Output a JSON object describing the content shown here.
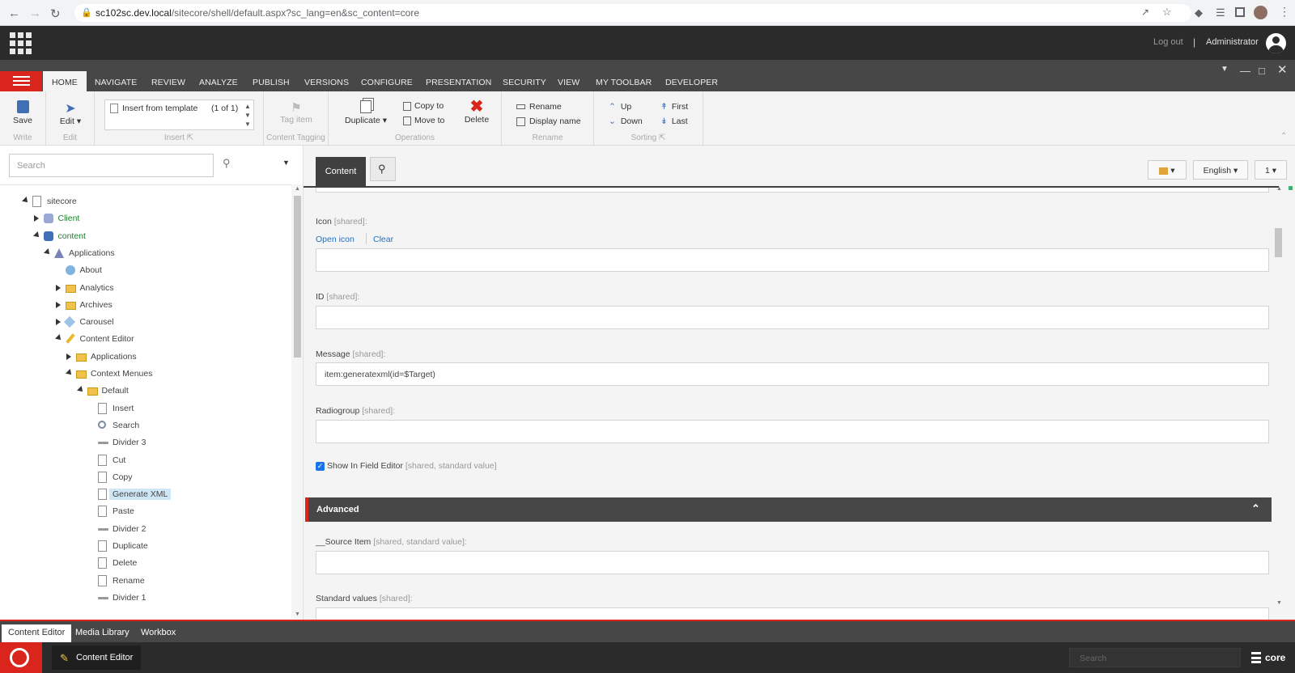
{
  "browser": {
    "url_domain": "sc102sc.dev.local",
    "url_path": "/sitecore/shell/default.aspx?sc_lang=en&sc_content=core"
  },
  "topbar": {
    "logout": "Log out",
    "separator": "|",
    "user": "Administrator"
  },
  "tabs": [
    "HOME",
    "NAVIGATE",
    "REVIEW",
    "ANALYZE",
    "PUBLISH",
    "VERSIONS",
    "CONFIGURE",
    "PRESENTATION",
    "SECURITY",
    "VIEW",
    "MY TOOLBAR",
    "DEVELOPER"
  ],
  "ribbon": {
    "write": {
      "save": "Save",
      "label": "Write"
    },
    "edit": {
      "edit": "Edit",
      "label": "Edit"
    },
    "insert": {
      "item": "Insert from template",
      "count": "(1 of 1)",
      "label": "Insert"
    },
    "tagging": {
      "tag": "Tag item",
      "label": "Content Tagging"
    },
    "operations": {
      "duplicate": "Duplicate",
      "copy": "Copy to",
      "move": "Move to",
      "delete": "Delete",
      "label": "Operations"
    },
    "rename": {
      "rename": "Rename",
      "display": "Display name",
      "label": "Rename"
    },
    "sorting": {
      "up": "Up",
      "down": "Down",
      "first": "First",
      "last": "Last",
      "label": "Sorting"
    }
  },
  "search": {
    "placeholder": "Search"
  },
  "tree": [
    {
      "label": "sitecore",
      "icon": "page",
      "indent": 0,
      "arrow": "open"
    },
    {
      "label": "Client",
      "icon": "client",
      "indent": 1,
      "arrow": "closed",
      "green": true
    },
    {
      "label": "content",
      "icon": "content",
      "indent": 1,
      "arrow": "open",
      "green": true
    },
    {
      "label": "Applications",
      "icon": "apps",
      "indent": 2,
      "arrow": "open"
    },
    {
      "label": "About",
      "icon": "info",
      "indent": 3,
      "arrow": ""
    },
    {
      "label": "Analytics",
      "icon": "folder",
      "indent": 3,
      "arrow": "closed"
    },
    {
      "label": "Archives",
      "icon": "folder",
      "indent": 3,
      "arrow": "closed"
    },
    {
      "label": "Carousel",
      "icon": "star",
      "indent": 3,
      "arrow": "closed"
    },
    {
      "label": "Content Editor",
      "icon": "pencil",
      "indent": 3,
      "arrow": "open"
    },
    {
      "label": "Applications",
      "icon": "folder",
      "indent": 4,
      "arrow": "closed"
    },
    {
      "label": "Context Menues",
      "icon": "folder",
      "indent": 4,
      "arrow": "open"
    },
    {
      "label": "Default",
      "icon": "folder",
      "indent": 5,
      "arrow": "open"
    },
    {
      "label": "Insert",
      "icon": "page",
      "indent": 6,
      "arrow": ""
    },
    {
      "label": "Search",
      "icon": "search",
      "indent": 6,
      "arrow": ""
    },
    {
      "label": "Divider 3",
      "icon": "div",
      "indent": 6,
      "arrow": ""
    },
    {
      "label": "Cut",
      "icon": "page",
      "indent": 6,
      "arrow": ""
    },
    {
      "label": "Copy",
      "icon": "page",
      "indent": 6,
      "arrow": ""
    },
    {
      "label": "Generate XML",
      "icon": "page",
      "indent": 6,
      "arrow": "",
      "selected": true
    },
    {
      "label": "Paste",
      "icon": "page",
      "indent": 6,
      "arrow": ""
    },
    {
      "label": "Divider 2",
      "icon": "div",
      "indent": 6,
      "arrow": ""
    },
    {
      "label": "Duplicate",
      "icon": "page",
      "indent": 6,
      "arrow": ""
    },
    {
      "label": "Delete",
      "icon": "page",
      "indent": 6,
      "arrow": ""
    },
    {
      "label": "Rename",
      "icon": "page",
      "indent": 6,
      "arrow": ""
    },
    {
      "label": "Divider 1",
      "icon": "div",
      "indent": 6,
      "arrow": ""
    }
  ],
  "editor": {
    "content_tab": "Content",
    "language": "English",
    "version": "1"
  },
  "fields": {
    "icon_label": "Icon",
    "icon_shared": "[shared]:",
    "open_icon": "Open icon",
    "clear": "Clear",
    "id_label": "ID",
    "id_shared": "[shared]:",
    "message_label": "Message",
    "message_shared": "[shared]:",
    "message_value": "item:generatexml(id=$Target)",
    "radiogroup_label": "Radiogroup",
    "radiogroup_shared": "[shared]:",
    "show_label": "Show In Field Editor",
    "show_shared": "[shared, standard value]",
    "advanced": "Advanced",
    "source_label": "__Source Item",
    "source_shared": "[shared, standard value]:",
    "standard_label": "Standard values",
    "standard_shared": "[shared]:"
  },
  "bottom_tabs": [
    "Content Editor",
    "Media Library",
    "Workbox"
  ],
  "taskbar": {
    "app": "Content Editor",
    "search_placeholder": "Search",
    "db": "core"
  }
}
